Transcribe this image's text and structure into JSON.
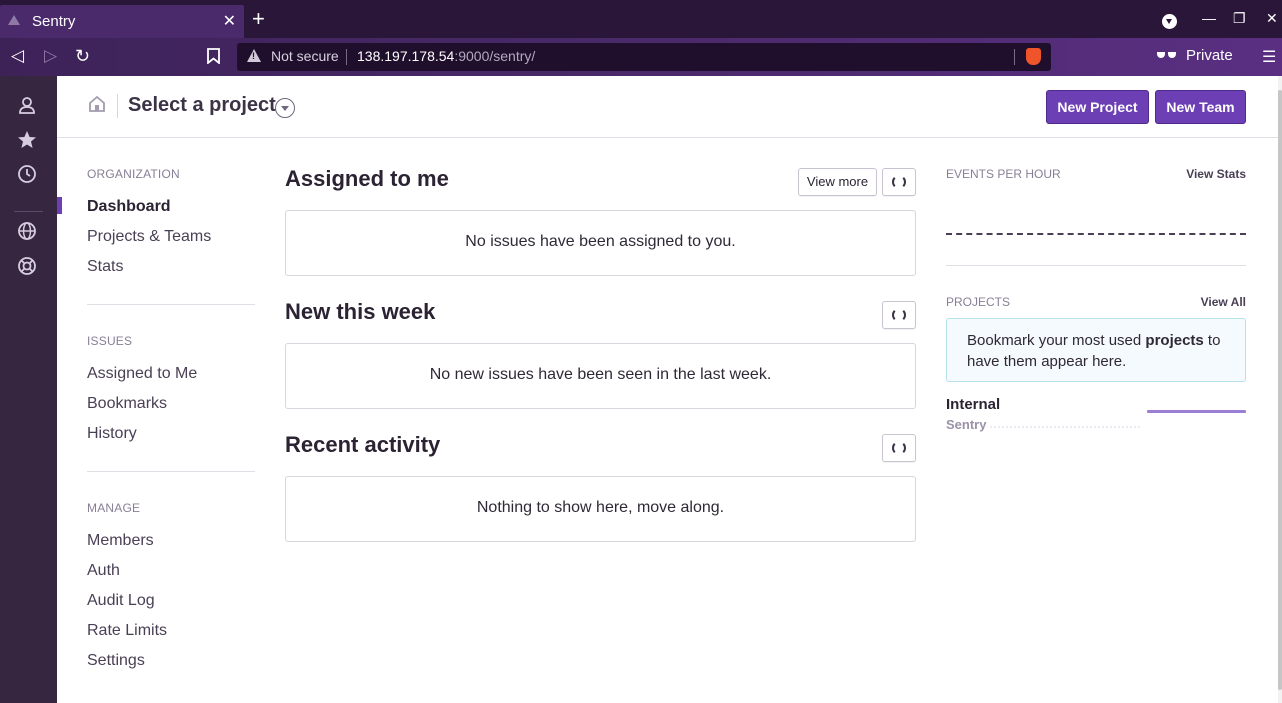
{
  "browser": {
    "tab_title": "Sentry",
    "tab_close": "✕",
    "new_tab": "+",
    "url_warning": "Not secure",
    "url_host": "138.197.178.54",
    "url_rest": ":9000/sentry/",
    "private_label": "Private",
    "back": "◁",
    "forward": "▷",
    "reload": "↻",
    "bookmark": "🔖",
    "menu": "☰",
    "minimize": "—",
    "maximize": "❐",
    "close": "✕"
  },
  "header": {
    "title": "Select a project",
    "new_project": "New Project",
    "new_team": "New Team"
  },
  "leftnav": {
    "org_heading": "ORGANIZATION",
    "org_items": [
      "Dashboard",
      "Projects & Teams",
      "Stats"
    ],
    "issues_heading": "ISSUES",
    "issues_items": [
      "Assigned to Me",
      "Bookmarks",
      "History"
    ],
    "manage_heading": "MANAGE",
    "manage_items": [
      "Members",
      "Auth",
      "Audit Log",
      "Rate Limits",
      "Settings"
    ]
  },
  "main": {
    "assigned_title": "Assigned to me",
    "view_more": "View more",
    "assigned_empty": "No issues have been assigned to you.",
    "new_title": "New this week",
    "new_empty": "No new issues have been seen in the last week.",
    "activity_title": "Recent activity",
    "activity_empty": "Nothing to show here, move along."
  },
  "right": {
    "events_heading": "EVENTS PER HOUR",
    "view_stats": "View Stats",
    "projects_heading": "PROJECTS",
    "view_all": "View All",
    "bookmark_pre": "Bookmark your most used ",
    "bookmark_bold": "projects",
    "bookmark_post": " to have them appear here.",
    "project_name": "Internal",
    "project_team": "Sentry"
  },
  "icons": {
    "rail": [
      "user-icon",
      "star-icon",
      "clock-icon",
      "globe-icon",
      "lifebuoy-icon"
    ]
  },
  "colors": {
    "accent": "#6c3fb5",
    "sidebar": "#36263f",
    "browser_chrome": "#2a1639"
  }
}
